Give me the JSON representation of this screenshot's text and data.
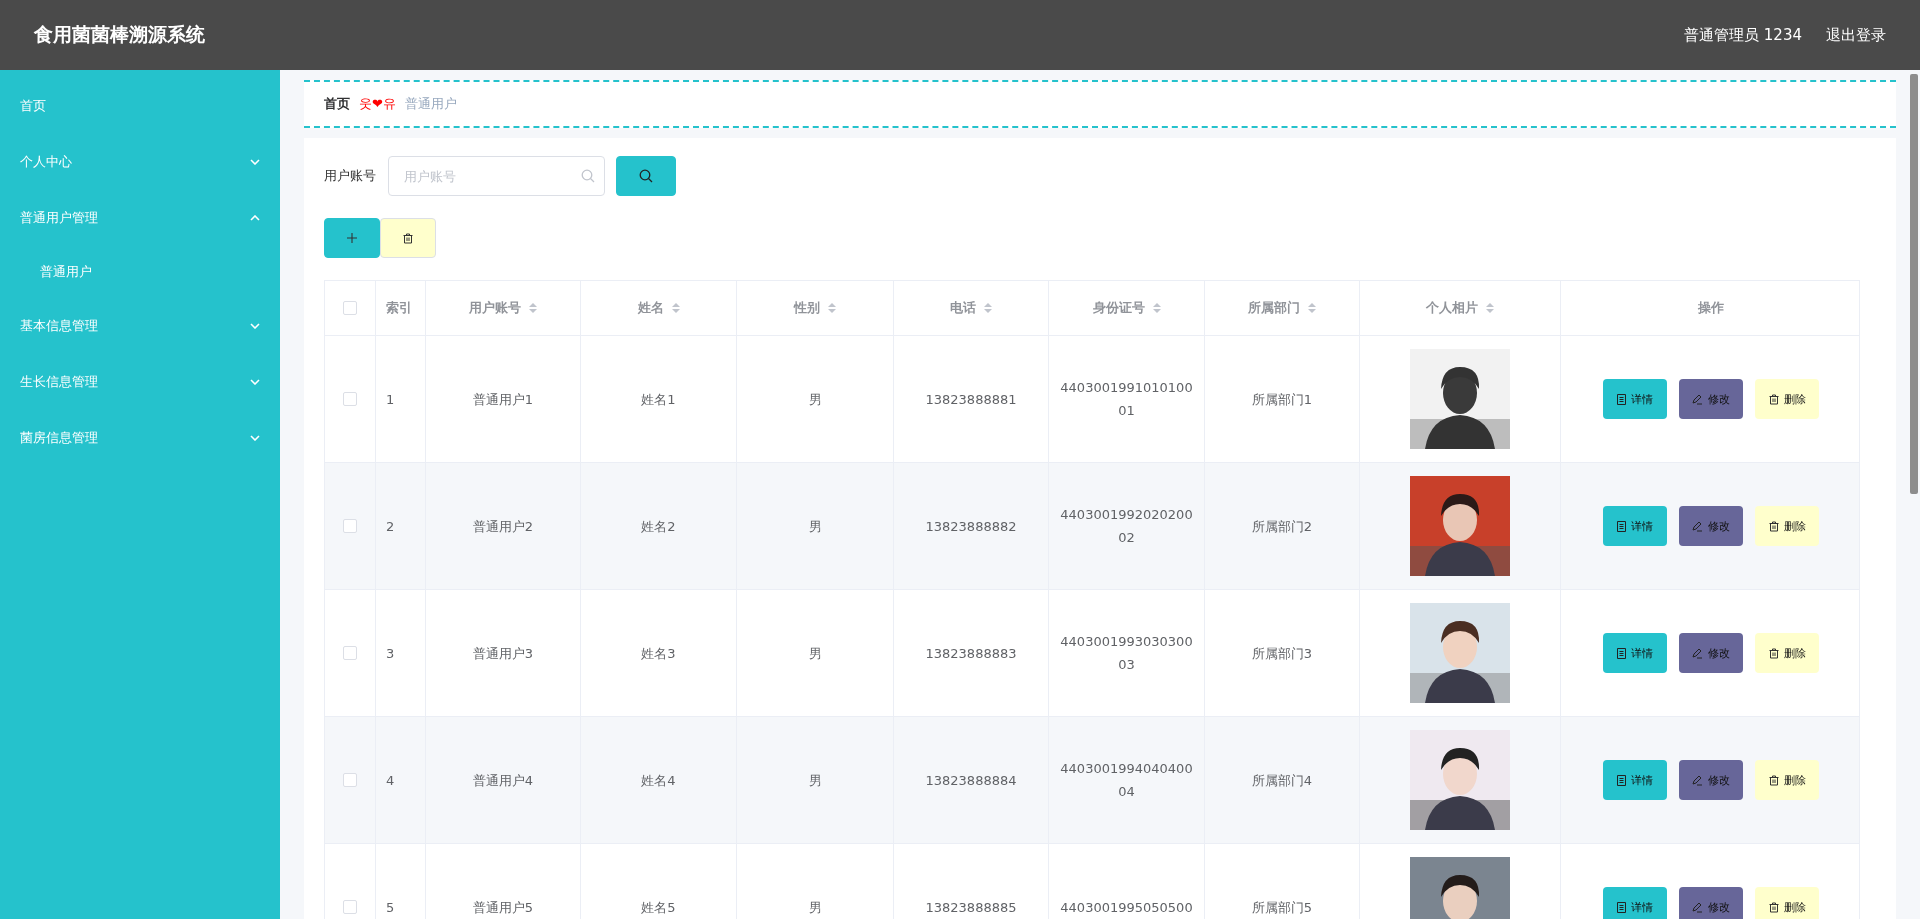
{
  "header": {
    "title": "食用菌菌棒溯源系统",
    "user": "普通管理员 1234",
    "logout": "退出登录"
  },
  "sidebar": {
    "items": [
      {
        "label": "首页"
      },
      {
        "label": "个人中心",
        "expanded": false
      },
      {
        "label": "普通用户管理",
        "expanded": true,
        "children": [
          {
            "label": "普通用户"
          }
        ]
      },
      {
        "label": "基本信息管理",
        "expanded": false
      },
      {
        "label": "生长信息管理",
        "expanded": false
      },
      {
        "label": "菌房信息管理",
        "expanded": false
      }
    ]
  },
  "breadcrumb": {
    "home": "首页",
    "separator": "웃❤유",
    "current": "普通用户"
  },
  "search": {
    "label": "用户账号",
    "placeholder": "用户账号"
  },
  "table": {
    "all_checked": false,
    "columns": [
      {
        "label": "索引",
        "sortable": false
      },
      {
        "label": "用户账号",
        "sortable": true
      },
      {
        "label": "姓名",
        "sortable": true
      },
      {
        "label": "性别",
        "sortable": true
      },
      {
        "label": "电话",
        "sortable": true
      },
      {
        "label": "身份证号",
        "sortable": true
      },
      {
        "label": "所属部门",
        "sortable": true
      },
      {
        "label": "个人相片",
        "sortable": true
      },
      {
        "label": "操作",
        "sortable": false
      }
    ],
    "rows": [
      {
        "checked": false,
        "cells": [
          "1",
          "普通用户1",
          "姓名1",
          "男",
          "13823888881",
          "440300199101010001",
          "所属部门1"
        ],
        "actions": [
          "详情",
          "修改",
          "删除"
        ]
      },
      {
        "checked": false,
        "cells": [
          "2",
          "普通用户2",
          "姓名2",
          "男",
          "13823888882",
          "440300199202020002",
          "所属部门2"
        ],
        "actions": [
          "详情",
          "修改",
          "删除"
        ]
      },
      {
        "checked": false,
        "cells": [
          "3",
          "普通用户3",
          "姓名3",
          "男",
          "13823888883",
          "440300199303030003",
          "所属部门3"
        ],
        "actions": [
          "详情",
          "修改",
          "删除"
        ]
      },
      {
        "checked": false,
        "cells": [
          "4",
          "普通用户4",
          "姓名4",
          "男",
          "13823888884",
          "440300199404040004",
          "所属部门4"
        ],
        "actions": [
          "详情",
          "修改",
          "删除"
        ]
      },
      {
        "checked": false,
        "cells": [
          "5",
          "普通用户5",
          "姓名5",
          "男",
          "13823888885",
          "4403001995050500",
          "所属部门5"
        ],
        "actions": [
          "详情",
          "修改",
          "删除"
        ]
      }
    ]
  }
}
